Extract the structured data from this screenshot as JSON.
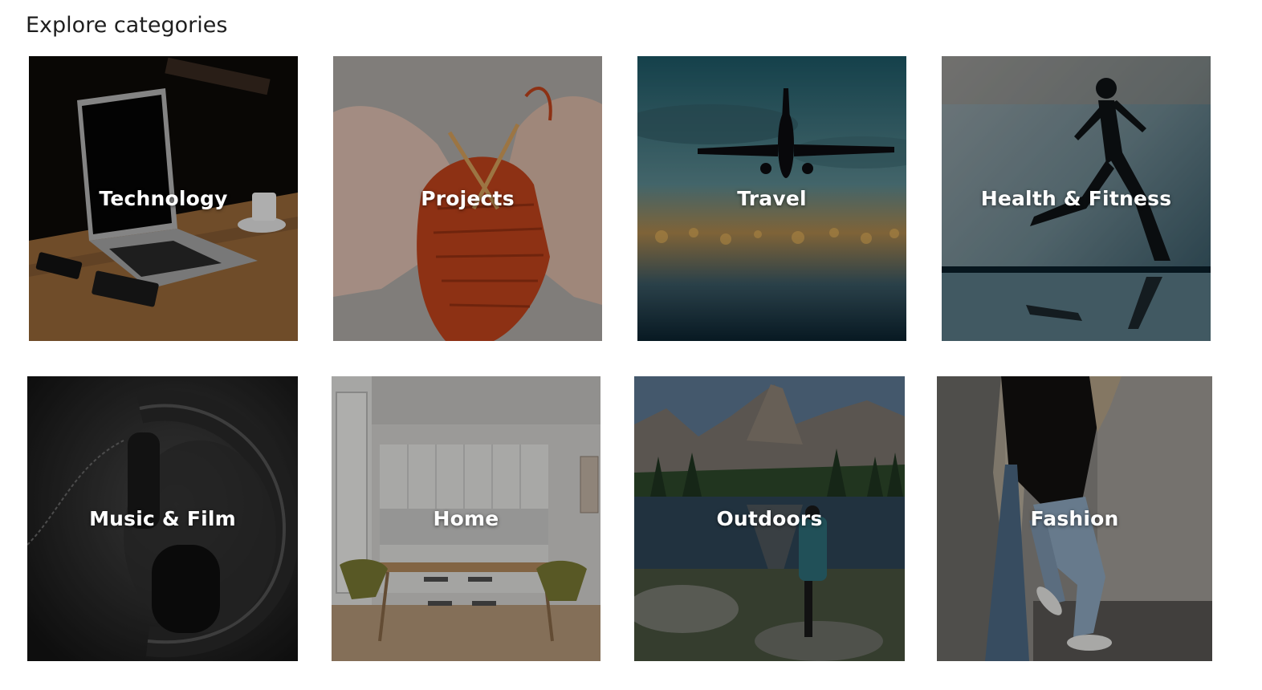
{
  "heading": "Explore categories",
  "categories": [
    {
      "label": "Technology",
      "image": "laptop-on-wooden-desk"
    },
    {
      "label": "Projects",
      "image": "hands-knitting-orange-yarn"
    },
    {
      "label": "Travel",
      "image": "airplane-over-city-lights"
    },
    {
      "label": "Health & Fitness",
      "image": "runner-silhouette-reflection"
    },
    {
      "label": "Music & Film",
      "image": "headphones-black-and-white"
    },
    {
      "label": "Home",
      "image": "white-kitchen-dining-room"
    },
    {
      "label": "Outdoors",
      "image": "hiker-at-mountain-lake"
    },
    {
      "label": "Fashion",
      "image": "person-in-jeans-against-wall"
    }
  ]
}
